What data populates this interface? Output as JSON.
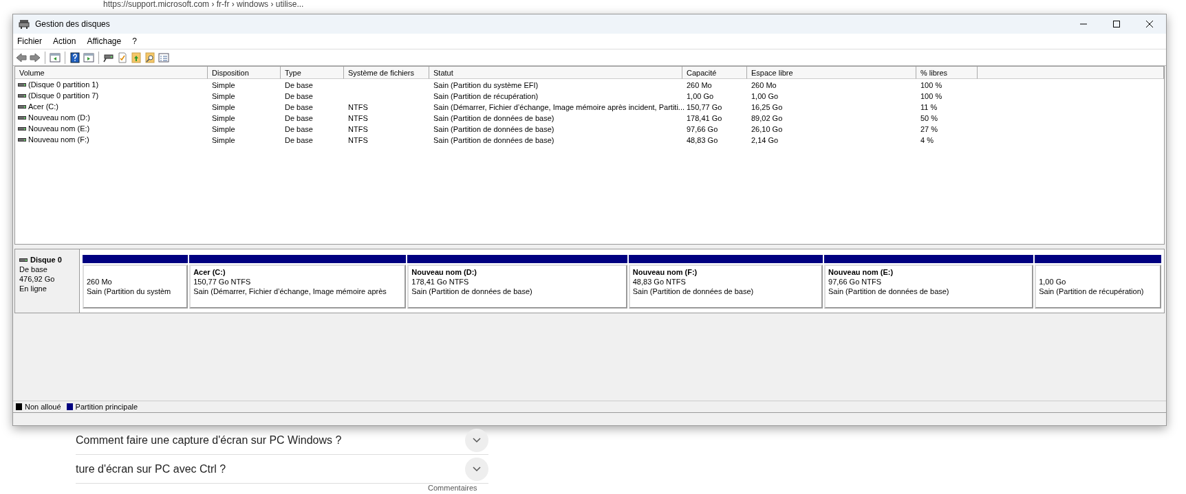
{
  "background_page": {
    "breadcrumb": "https://support.microsoft.com › fr-fr › windows › utilise...",
    "questions": [
      {
        "text": "Comment faire une capture d'écran sur PC Windows ?"
      },
      {
        "text": "ture d'écran sur PC avec Ctrl ?"
      }
    ],
    "footer_link": "Commentaires"
  },
  "window": {
    "title": "Gestion des disques"
  },
  "menu": [
    "Fichier",
    "Action",
    "Affichage",
    "?"
  ],
  "volumes": {
    "columns": [
      "Volume",
      "Disposition",
      "Type",
      "Système de fichiers",
      "Statut",
      "Capacité",
      "Espace libre",
      "% libres"
    ],
    "rows": [
      [
        "(Disque 0 partition 1)",
        "Simple",
        "De base",
        null,
        "Sain (Partition du système EFI)",
        "260 Mo",
        "260 Mo",
        "100 %"
      ],
      [
        "(Disque 0 partition 7)",
        "Simple",
        "De base",
        null,
        "Sain (Partition de récupération)",
        "1,00 Go",
        "1,00 Go",
        "100 %"
      ],
      [
        "Acer (C:)",
        "Simple",
        "De base",
        "NTFS",
        "Sain (Démarrer, Fichier d’échange, Image mémoire après incident, Partiti...",
        "150,77 Go",
        "16,25 Go",
        "11 %"
      ],
      [
        "Nouveau nom (D:)",
        "Simple",
        "De base",
        "NTFS",
        "Sain (Partition de données de base)",
        "178,41 Go",
        "89,02 Go",
        "50 %"
      ],
      [
        "Nouveau nom (E:)",
        "Simple",
        "De base",
        "NTFS",
        "Sain (Partition de données de base)",
        "97,66 Go",
        "26,10 Go",
        "27 %"
      ],
      [
        "Nouveau nom (F:)",
        "Simple",
        "De base",
        "NTFS",
        "Sain (Partition de données de base)",
        "48,83 Go",
        "2,14 Go",
        "4 %"
      ]
    ]
  },
  "disk": {
    "name": "Disque 0",
    "type": "De base",
    "size": "476,92 Go",
    "state": "En ligne",
    "partitions": [
      {
        "size": "260 Mo",
        "status": "Sain (Partition du systèm",
        "color": "#000080"
      },
      {
        "name": "Acer  (C:)",
        "size": "150,77 Go NTFS",
        "status": "Sain (Démarrer, Fichier d’échange, Image mémoire après",
        "color": "#000080"
      },
      {
        "name": "Nouveau nom  (D:)",
        "size": "178,41 Go NTFS",
        "status": "Sain (Partition de données de base)",
        "color": "#000080"
      },
      {
        "name": "Nouveau nom  (F:)",
        "size": "48,83 Go NTFS",
        "status": "Sain (Partition de données de base)",
        "color": "#000080"
      },
      {
        "name": "Nouveau nom  (E:)",
        "size": "97,66 Go NTFS",
        "status": "Sain (Partition de données de base)",
        "color": "#000080"
      },
      {
        "size": "1,00 Go",
        "status": "Sain (Partition de récupération)",
        "color": "#000080"
      }
    ]
  },
  "legend": [
    {
      "label": "Non alloué",
      "color": "#000000"
    },
    {
      "label": "Partition principale",
      "color": "#000080"
    }
  ]
}
